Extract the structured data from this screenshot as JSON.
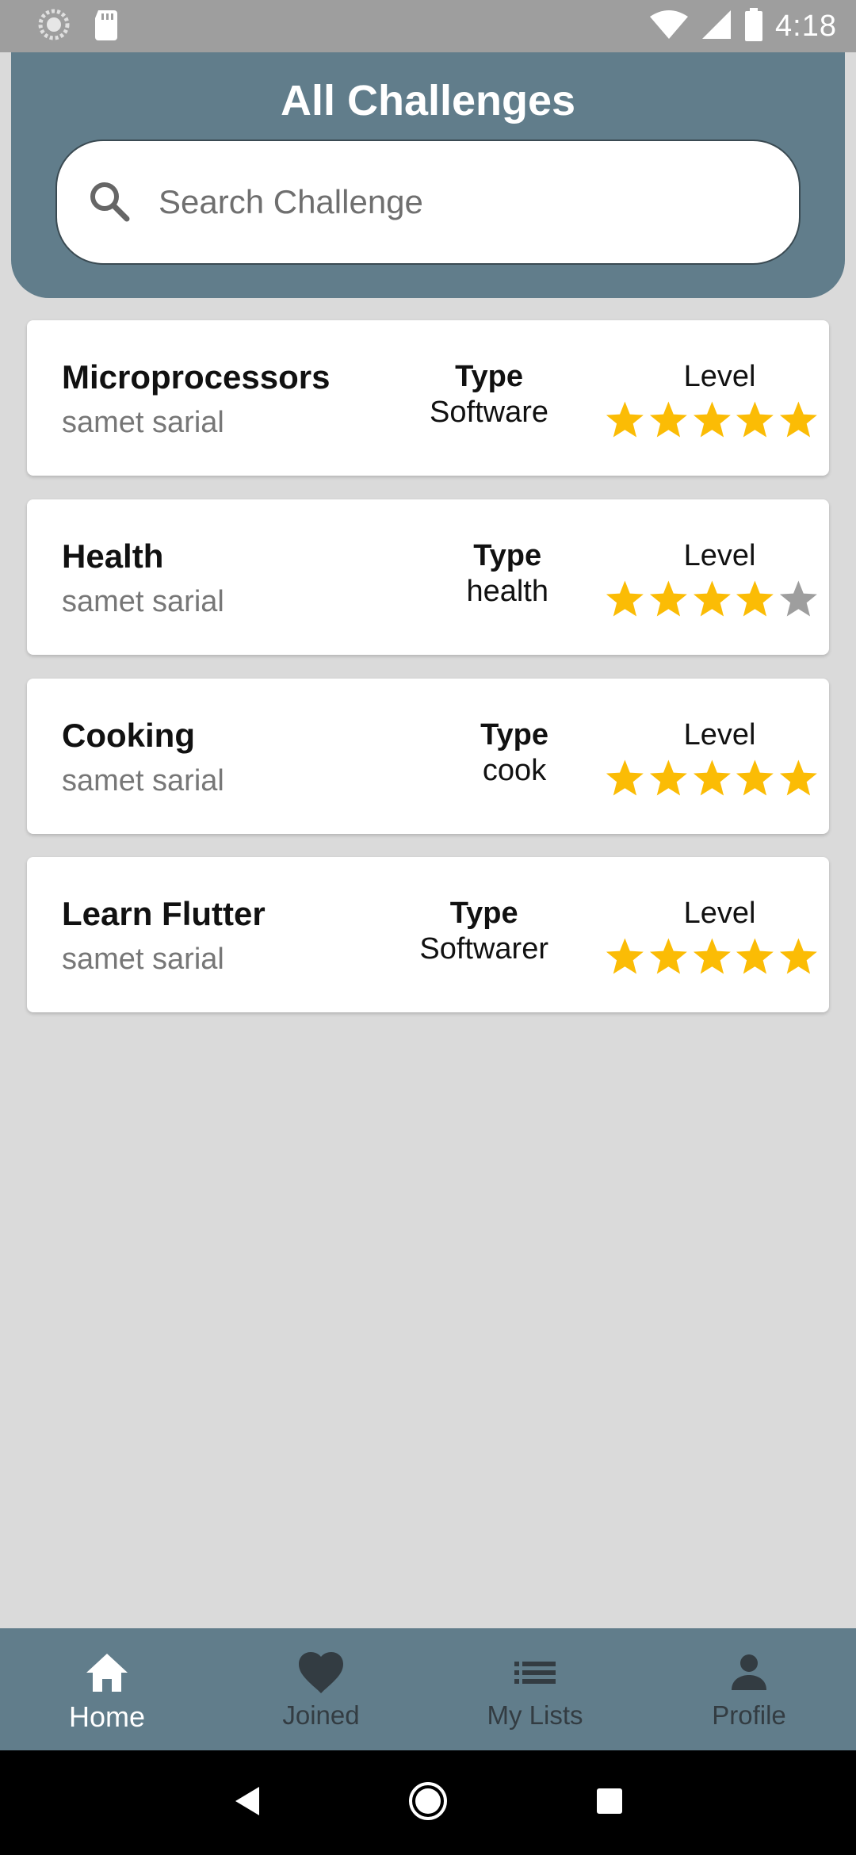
{
  "status_bar": {
    "time": "4:18",
    "icons": [
      "loading-icon",
      "sd-card-icon",
      "wifi-icon",
      "signal-icon",
      "battery-icon"
    ]
  },
  "header": {
    "title": "All Challenges",
    "search": {
      "placeholder": "Search Challenge",
      "value": ""
    }
  },
  "challenges": [
    {
      "title": "Microprocessors",
      "author": "samet sarial",
      "type_label": "Type",
      "type": "Software",
      "level_label": "Level",
      "rating": 5,
      "max_rating": 5
    },
    {
      "title": "Health",
      "author": "samet sarial",
      "type_label": "Type",
      "type": "health",
      "level_label": "Level",
      "rating": 4,
      "max_rating": 5
    },
    {
      "title": "Cooking",
      "author": "samet sarial",
      "type_label": "Type",
      "type": "cook",
      "level_label": "Level",
      "rating": 5,
      "max_rating": 5
    },
    {
      "title": "Learn Flutter",
      "author": "samet sarial",
      "type_label": "Type",
      "type": "Softwarer",
      "level_label": "Level",
      "rating": 5,
      "max_rating": 5
    }
  ],
  "bottom_nav": {
    "items": [
      {
        "label": "Home",
        "icon": "home-icon",
        "active": true
      },
      {
        "label": "Joined",
        "icon": "heart-icon",
        "active": false
      },
      {
        "label": "My Lists",
        "icon": "list-icon",
        "active": false
      },
      {
        "label": "Profile",
        "icon": "person-icon",
        "active": false
      }
    ]
  },
  "colors": {
    "header": "#617d8b",
    "star_filled": "#fbbc05",
    "star_empty": "#9e9e9e",
    "background": "#dadada"
  }
}
